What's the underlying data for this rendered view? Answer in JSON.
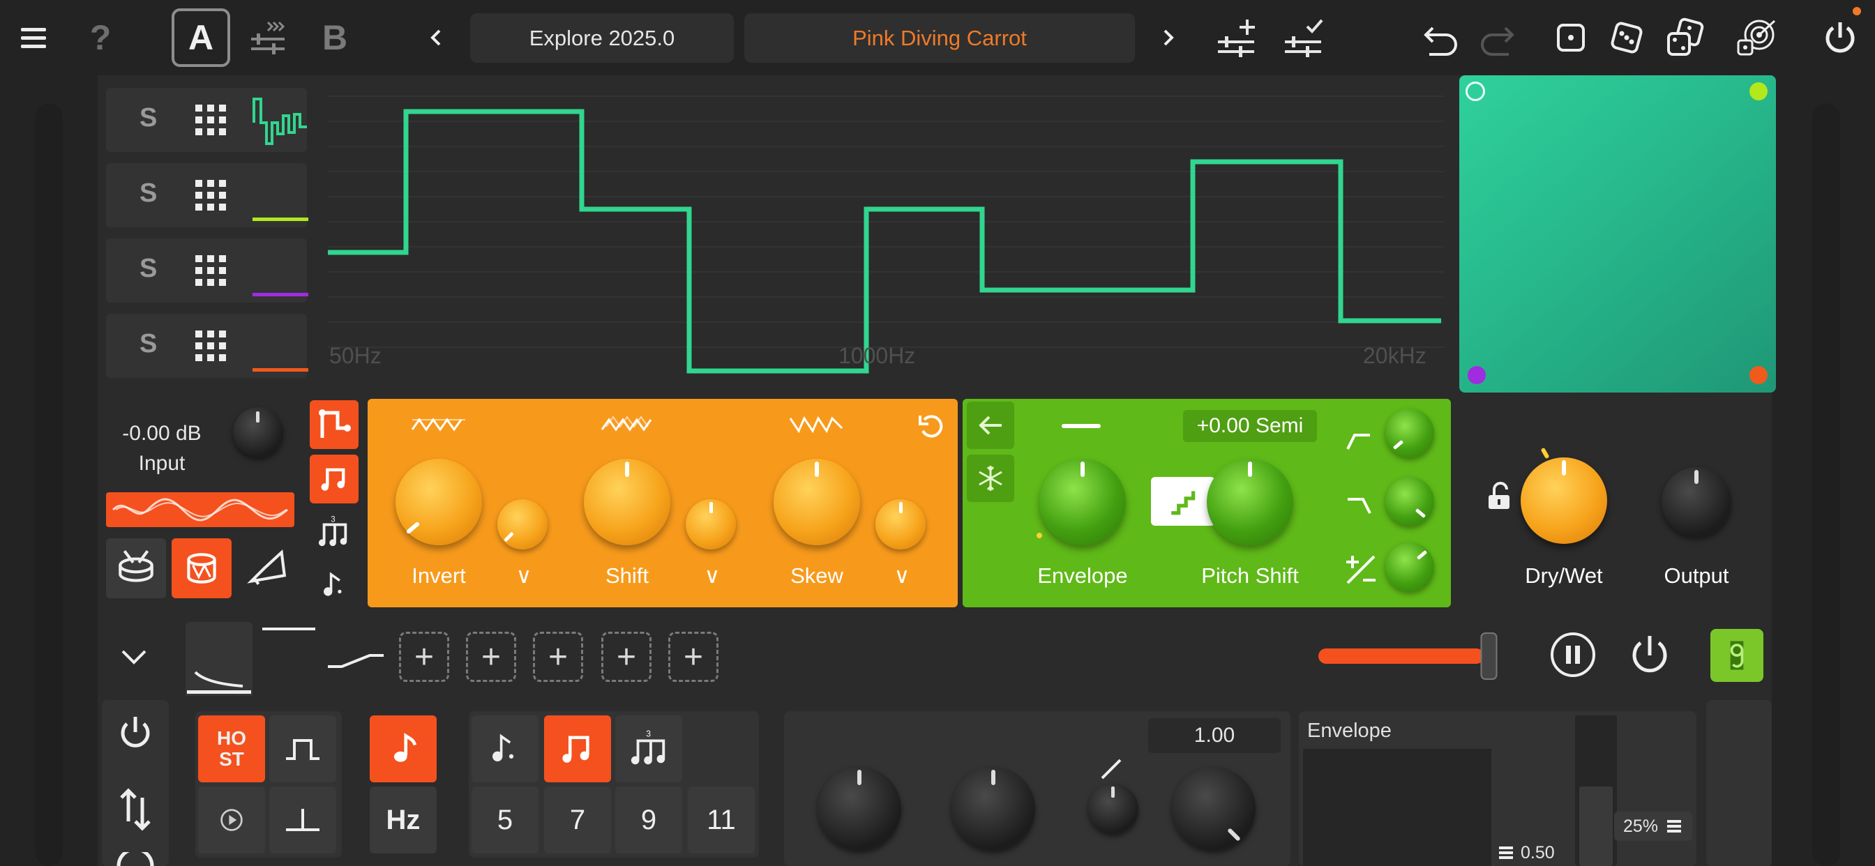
{
  "topbar": {
    "help_label": "?",
    "slot_a": "A",
    "slot_b": "B",
    "preset_bank": "Explore 2025.0",
    "preset_name": "Pink Diving Carrot",
    "preset_name_color": "#f07a28",
    "icons": [
      "menu-icon",
      "help-icon",
      "copy-a-to-b-icon",
      "prev-icon",
      "next-icon",
      "save-new-icon",
      "save-icon",
      "undo-icon",
      "redo-icon",
      "dice-1-icon",
      "dice-2-icon",
      "dice-3-icon",
      "target-random-icon",
      "power-icon"
    ]
  },
  "lanes": {
    "items": [
      {
        "solo": "S",
        "color": "#31d68f"
      },
      {
        "solo": "S",
        "color": "#b2e81c"
      },
      {
        "solo": "S",
        "color": "#a02ce0"
      },
      {
        "solo": "S",
        "color": "#f05a1c"
      }
    ],
    "graph": {
      "line_color": "#31d68f",
      "freq_labels": [
        "50Hz",
        "1000Hz",
        "20kHz"
      ]
    }
  },
  "xy_pad": {
    "corner_colors": [
      "#2fd19c",
      "#b2e81c",
      "#a02ce0",
      "#f05a1c"
    ]
  },
  "input": {
    "level": "-0.00 dB",
    "label": "Input"
  },
  "orange_module": {
    "knobs": [
      {
        "label": "Invert"
      },
      {
        "label": "Shift"
      },
      {
        "label": "Skew"
      }
    ],
    "dropdown_glyph": "∨",
    "reset_icon": "reset-icon"
  },
  "green_module": {
    "semi": "+0.00 Semi",
    "knobs": [
      {
        "label": "Envelope"
      },
      {
        "label": "Pitch Shift"
      }
    ]
  },
  "mix": {
    "drywet_label": "Dry/Wet",
    "output_label": "Output"
  },
  "sequencer": {
    "host_label": "HO\nST",
    "hz_label": "Hz",
    "numbers": [
      "5",
      "7",
      "9",
      "11"
    ],
    "triplet_mark": "3",
    "value_display": "1.00",
    "envelope_title": "Envelope",
    "env_value": "0.50",
    "env_percent": "25%",
    "slider_level": 0.95,
    "slider_color": "#f4511e"
  }
}
